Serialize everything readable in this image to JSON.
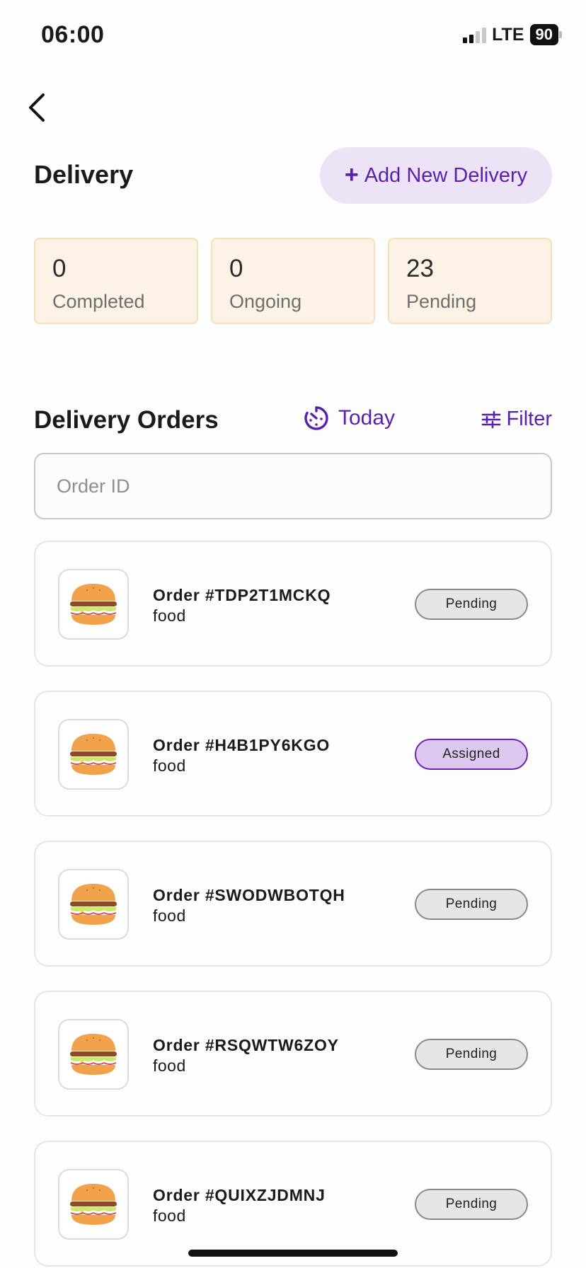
{
  "status_bar": {
    "time": "06:00",
    "network": "LTE",
    "battery": "90"
  },
  "header": {
    "title": "Delivery",
    "add_button_label": "Add New Delivery"
  },
  "stats": [
    {
      "value": "0",
      "label": "Completed"
    },
    {
      "value": "0",
      "label": "Ongoing"
    },
    {
      "value": "23",
      "label": "Pending"
    }
  ],
  "orders_section": {
    "title": "Delivery Orders",
    "date_filter_label": "Today",
    "filter_label": "Filter",
    "search_placeholder": "Order ID"
  },
  "orders": [
    {
      "id": "Order #TDP2T1MCKQ",
      "type": "food",
      "status": "Pending"
    },
    {
      "id": "Order #H4B1PY6KGO",
      "type": "food",
      "status": "Assigned"
    },
    {
      "id": "Order #SWODWBOTQH",
      "type": "food",
      "status": "Pending"
    },
    {
      "id": "Order #RSQWTW6ZOY",
      "type": "food",
      "status": "Pending"
    },
    {
      "id": "Order #QUIXZJDMNJ",
      "type": "food",
      "status": "Pending"
    }
  ],
  "colors": {
    "accent": "#5b1fb0",
    "accent_bg": "#ece4f6",
    "stat_bg": "#fcf3e6",
    "stat_border": "#f7dfb7",
    "assigned_bg": "#dcc8ef",
    "pending_bg": "#e6e6e6"
  },
  "icons": {
    "back": "chevron-left-icon",
    "add": "plus-icon",
    "today": "clock-icon",
    "filter": "sliders-icon",
    "order_thumb": "burger-icon"
  }
}
